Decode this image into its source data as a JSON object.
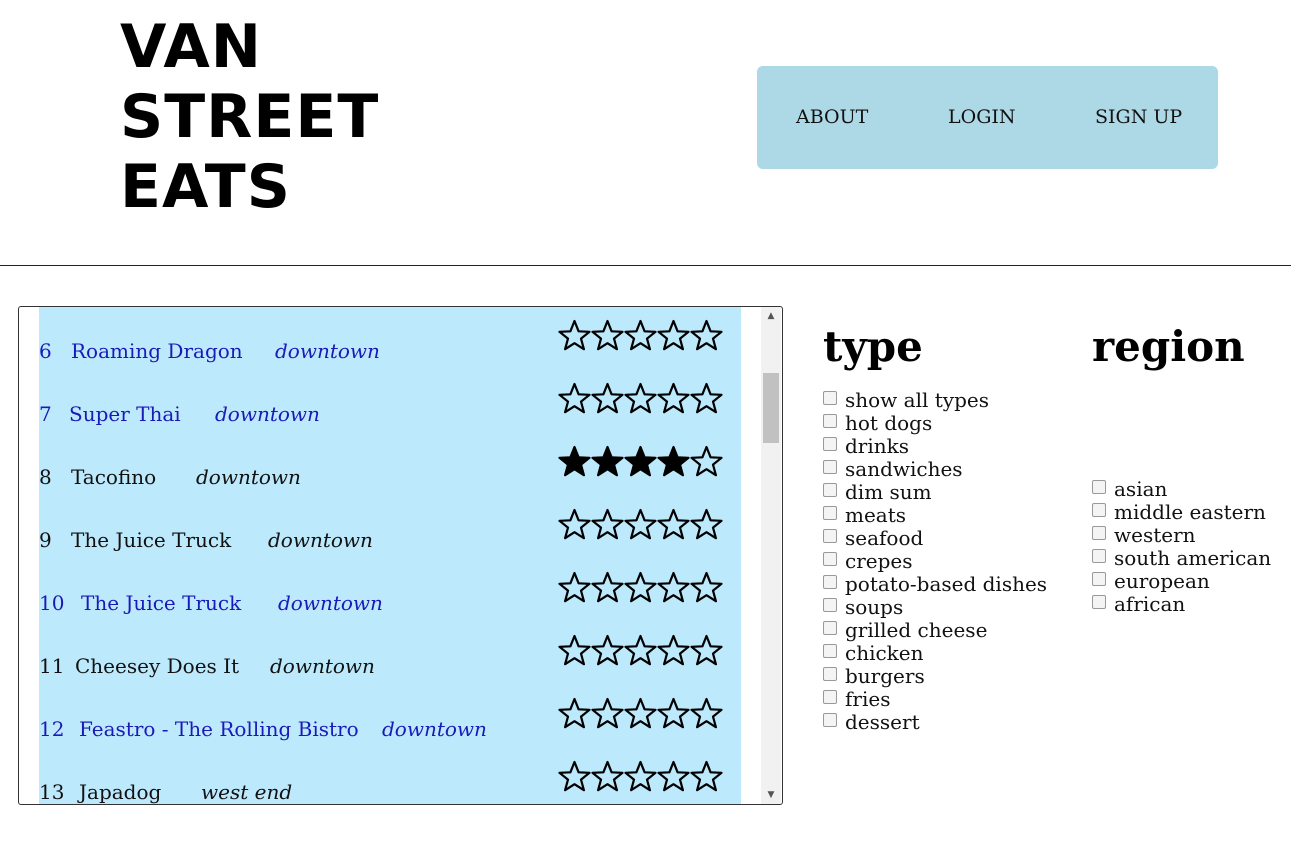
{
  "header": {
    "logo_lines": [
      "VAN",
      "STREET",
      "EATS"
    ],
    "nav": [
      "ABOUT",
      "LOGIN",
      "SIGN UP"
    ]
  },
  "list": {
    "rows": [
      {
        "num": "6",
        "name": "Roaming Dragon",
        "region": "downtown",
        "rating": 0,
        "link": true
      },
      {
        "num": "7",
        "name": "Super Thai",
        "region": "downtown",
        "rating": 0,
        "link": true
      },
      {
        "num": "8",
        "name": "Tacofino",
        "region": "downtown",
        "rating": 4,
        "link": false
      },
      {
        "num": "9",
        "name": "The Juice Truck",
        "region": "downtown",
        "rating": 0,
        "link": false
      },
      {
        "num": "10",
        "name": "The Juice Truck",
        "region": "downtown",
        "rating": 0,
        "link": true
      },
      {
        "num": "11",
        "name": "Cheesey Does It",
        "region": "downtown",
        "rating": 0,
        "link": false
      },
      {
        "num": "12",
        "name": "Feastro - The Rolling Bistro",
        "region": "downtown",
        "rating": 0,
        "link": true
      },
      {
        "num": "13",
        "name": "Japadog",
        "region": "west end",
        "rating": 0,
        "link": false
      }
    ]
  },
  "filters": {
    "type_title": "type",
    "region_title": "region",
    "types": [
      "show all types",
      "hot dogs",
      "drinks",
      "sandwiches",
      "dim sum",
      "meats",
      "seafood",
      "crepes",
      "potato-based dishes",
      "soups",
      "grilled cheese",
      "chicken",
      "burgers",
      "fries",
      "dessert"
    ],
    "regions": [
      "asian",
      "middle eastern",
      "western",
      "south american",
      "european",
      "african"
    ]
  },
  "colors": {
    "nav_bg": "#add8e6",
    "list_bg": "#bde9fc",
    "link": "#1a1ab8"
  }
}
